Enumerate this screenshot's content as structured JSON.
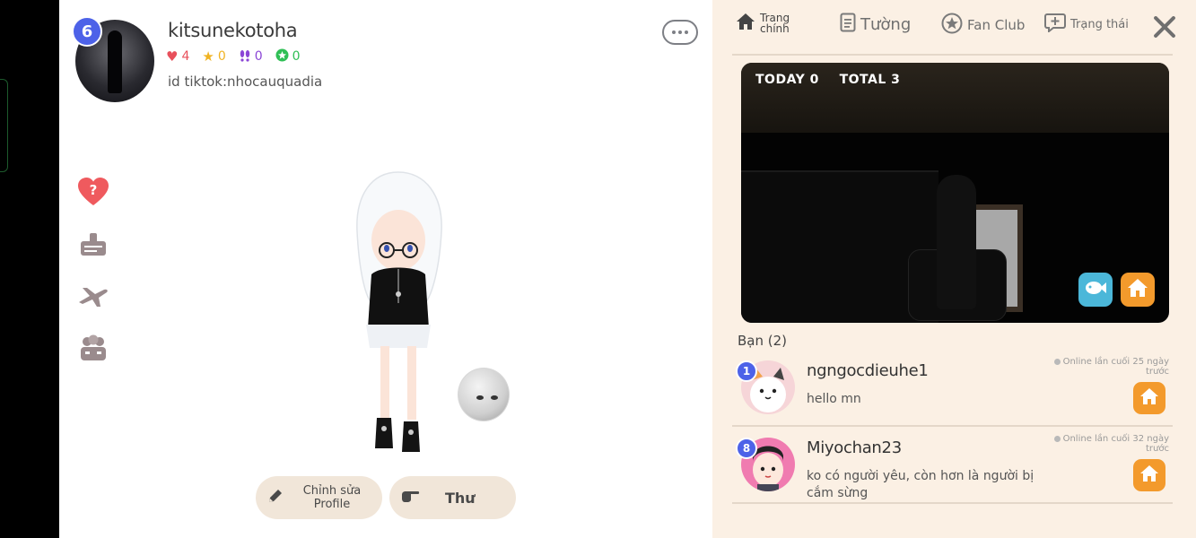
{
  "profile": {
    "level": "6",
    "username": "kitsunekotoha",
    "bio": "id tiktok:nhocauquadia",
    "stats": {
      "hearts": "4",
      "stars": "0",
      "footprints": "0",
      "clovers": "0"
    }
  },
  "buttons": {
    "edit_profile": "Chỉnh sửa Profile",
    "mail": "Thư"
  },
  "nav": {
    "home": "Trang chính",
    "wall": "Tường",
    "fan_club": "Fan Club",
    "status": "Trạng thái"
  },
  "room": {
    "today_label": "TODAY",
    "today_value": "0",
    "total_label": "TOTAL",
    "total_value": "3"
  },
  "friends": {
    "title": "Bạn (2)",
    "items": [
      {
        "level": "1",
        "name": "ngngocdieuhe1",
        "message": "hello mn",
        "online": "Online lần cuối 25 ngày trước"
      },
      {
        "level": "8",
        "name": "Miyochan23",
        "message": "ko có người yêu, còn hơn là người bị cắm sừng",
        "online": "Online lần cuối 32 ngày trước"
      }
    ]
  },
  "colors": {
    "accent_blue": "#4d62e8",
    "home_orange": "#f39a2c",
    "fish_blue": "#4bb7d9",
    "panel_bg": "#fbf0e4",
    "button_bg": "#f1e6d9"
  },
  "icons": {
    "side": [
      "heart-question-icon",
      "badge-icon",
      "airplane-icon",
      "group-icon"
    ]
  }
}
